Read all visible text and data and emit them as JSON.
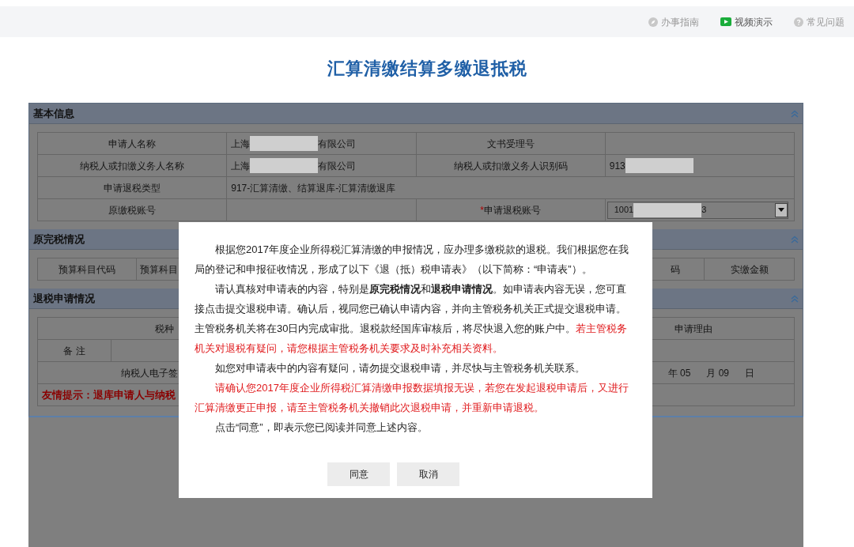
{
  "top_links": [
    {
      "label": "办事指南",
      "kind": "guide"
    },
    {
      "label": "视频演示",
      "kind": "video"
    },
    {
      "label": "常见问题",
      "kind": "faq"
    }
  ],
  "page_title": "汇算清缴结算多缴退抵税",
  "basic_info": {
    "title": "基本信息",
    "rows": [
      [
        {
          "kind": "label",
          "text": "申请人名称"
        },
        {
          "kind": "redacted",
          "before": "上海",
          "after": "有限公司"
        },
        {
          "kind": "label",
          "text": "文书受理号"
        },
        {
          "kind": "empty"
        }
      ],
      [
        {
          "kind": "label",
          "text": "纳税人或扣缴义务人名称"
        },
        {
          "kind": "redacted",
          "before": "上海",
          "after": "有限公司"
        },
        {
          "kind": "label",
          "text": "纳税人或扣缴义务人识别码"
        },
        {
          "kind": "redacted",
          "before": "913"
        }
      ],
      [
        {
          "kind": "label",
          "text": "申请退税类型"
        },
        {
          "kind": "wide",
          "text": "917-汇算清缴、结算退库-汇算清缴退库"
        }
      ],
      [
        {
          "kind": "label",
          "text": "原缴税账号"
        },
        {
          "kind": "empty"
        },
        {
          "kind": "label",
          "text": "申请退税账号",
          "marker": "*"
        },
        {
          "kind": "select",
          "before": "1001",
          "after": "3"
        }
      ]
    ]
  },
  "paid_tax": {
    "title": "原完税情况",
    "cells": [
      "预算科目代码",
      "预算科目",
      "码",
      "实缴金额"
    ]
  },
  "refund": {
    "title": "退税申请情况",
    "tax_type": "税种",
    "reason": "申请理由",
    "remark": "备 注",
    "signature": "纳税人电子签",
    "date": [
      "年 05",
      "月 09",
      "日"
    ],
    "tip": "友情提示：退库申请人与纳税"
  },
  "dialog": {
    "paragraphs": [
      [
        {
          "kind": "plain",
          "text": "根据您2017年度企业所得税汇算清缴的申报情况，应办理多缴税款的退税。我们根据您在我局的登记和申报征收情况，形成了以下《退（抵）税申请表》（以下简称：“申请表”）。"
        }
      ],
      [
        {
          "kind": "plain",
          "text": "请认真核对申请表的内容，特别是**原完税情况**和**退税申请情况**。如申请表内容无误，您可直接点击提交退税申请。确认后，视同您已确认申请内容，并向主管税务机关正式提交退税申请。主管税务机关将在30日内完成审批。退税款经国库审核后，将尽快退入您的账户中。"
        },
        {
          "kind": "alert",
          "text": "若主管税务机关对退税有疑问，请您根据主管税务机关要求及时补充相关资料。"
        }
      ],
      [
        {
          "kind": "plain",
          "text": "如您对申请表中的内容有疑问，请勿提交退税申请，并尽快与主管税务机关联系。"
        }
      ],
      [
        {
          "kind": "alert",
          "text": "请确认您2017年度企业所得税汇算清缴申报数据填报无误，若您在发起退税申请后，又进行汇算清缴更正申报，请至主管税务机关撤销此次退税申请，并重新申请退税。"
        }
      ],
      [
        {
          "kind": "plain",
          "text": "点击“同意”，即表示您已阅读并同意上述内容。"
        }
      ]
    ],
    "buttons": [
      "同意",
      "取消"
    ]
  }
}
